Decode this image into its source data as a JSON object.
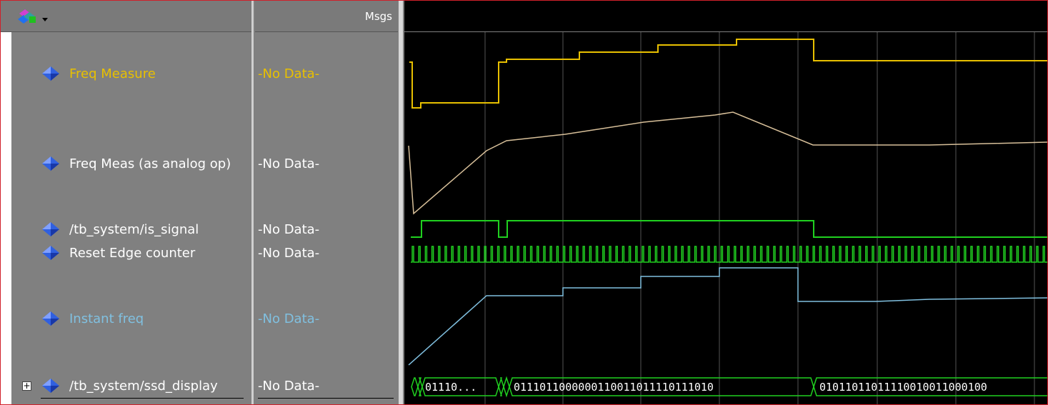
{
  "header": {
    "msgs_label": "Msgs"
  },
  "colors": {
    "yellow": "#e8c000",
    "tan": "#d8c09a",
    "green": "#20d020",
    "blue": "#80c0e0",
    "white": "#ffffff"
  },
  "signals": [
    {
      "name": "Freq Measure",
      "msg": "-No Data-",
      "color": "#e8c000",
      "icon": "diamond-icon"
    },
    {
      "name": "Freq Meas (as analog op)",
      "msg": "-No Data-",
      "color": "#ffffff",
      "icon": "diamond-icon"
    },
    {
      "name": "/tb_system/is_signal",
      "msg": "-No Data-",
      "color": "#ffffff",
      "icon": "diamond-icon"
    },
    {
      "name": "Reset Edge counter",
      "msg": "-No Data-",
      "color": "#ffffff",
      "icon": "diamond-icon"
    },
    {
      "name": "Instant freq",
      "msg": "-No Data-",
      "color": "#80c0e0",
      "icon": "diamond-icon"
    },
    {
      "name": "/tb_system/ssd_display",
      "msg": "-No Data-",
      "color": "#ffffff",
      "icon": "diamond-icon"
    }
  ],
  "bus_values": [
    "01110...",
    "0111011000000110011011110111010",
    "01011011011110010011000100"
  ],
  "expand_label": "+"
}
